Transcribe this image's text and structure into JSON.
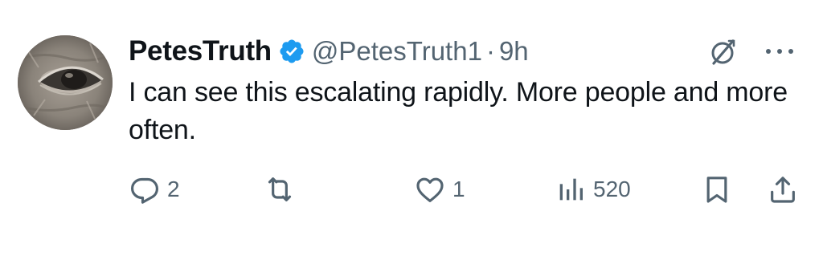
{
  "tweet": {
    "display_name": "PetesTruth",
    "handle": "@PetesTruth1",
    "separator": "·",
    "time": "9h",
    "text": "I can see this escalating rapidly. More people and more often.",
    "verified_color": "#1d9bf0",
    "icons": {
      "verified": "verified-badge-icon",
      "grok": "grok-icon",
      "more": "more-options-icon"
    }
  },
  "actions": {
    "reply_count": "2",
    "retweet_count": "",
    "like_count": "1",
    "views_count": "520",
    "icons": {
      "reply": "reply-icon",
      "retweet": "retweet-icon",
      "like": "heart-icon",
      "views": "views-icon",
      "bookmark": "bookmark-icon",
      "share": "share-icon"
    }
  },
  "colors": {
    "text_primary": "#0f1419",
    "text_secondary": "#536471",
    "verified_blue": "#1d9bf0"
  }
}
